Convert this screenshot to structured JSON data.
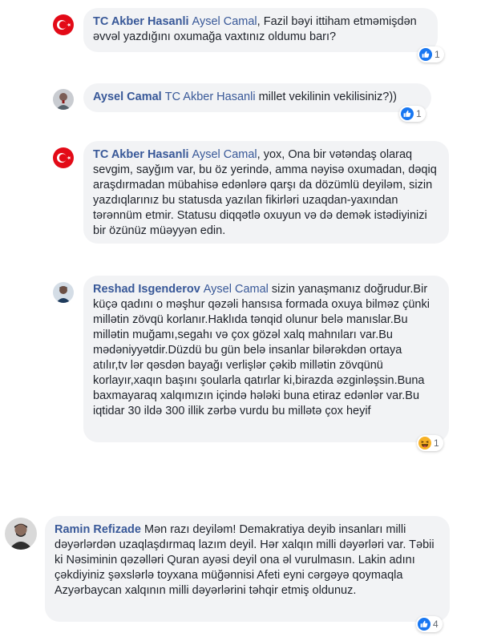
{
  "comments": [
    {
      "author": "TC Akber Hasanli",
      "mention": "Aysel Camal",
      "text": ", Fazil bəyi ittiham etməmişdən əvvəl yazdığını oxumağa vaxtınız oldumu barı?",
      "reaction": {
        "icon": "like-icon",
        "count": "1"
      },
      "avatar": "turkish-flag-avatar"
    },
    {
      "author": "Aysel Camal",
      "mention": "TC Akber Hasanli",
      "text": " millet vekilinin vekilisiniz?))",
      "reaction": {
        "icon": "like-icon",
        "count": "1"
      },
      "avatar": "user-photo-avatar"
    },
    {
      "author": "TC Akber Hasanli",
      "mention": "Aysel Camal",
      "text": ", yox, Ona bir vətəndaş olaraq sevgim, sayğım var, bu öz yerində, amma nəyisə oxumadan, dəqiq araşdırmadan mübahisə edənlərə qarşı da dözümlü deyiləm, sizin yazdıqlarınız bu statusda yazılan fikirləri uzaqdan-yaxından tərənnüm etmir. Statusu diqqətlə oxuyun və də demək istədiyinizi bir özünüz müəyyən edin.",
      "reaction": null,
      "avatar": "turkish-flag-avatar"
    },
    {
      "author": "Reshad Isgenderov",
      "mention": "Aysel Camal",
      "text": " sizin yanaşmanız doğrudur.Bir küçə qadını o məşhur qəzəli hansısa formada oxuya bilməz çünki millətin zövqü korlanır.Haklıda tənqid olunur belə manıslar.Bu millətin muğamı,segahı və çox gözəl xalq mahnıları var.Bu mədəniyyətdir.Düzdü bu gün belə insanlar bilərəkdən ortaya atılır,tv lər qəsdən bayağı verlişlər çəkib millətin zövqünü korlayır,xaqın başını şoularla qatırlar ki,birazda əzginləşsin.Buna baxmayaraq xalqımızın içində hələki buna etiraz edənlər var.Bu iqtidar 30 ildə 300 illik zərbə vurdu bu millətə çox heyif",
      "reaction": {
        "icon": "haha-icon",
        "count": "1"
      },
      "avatar": "user-photo-avatar"
    },
    {
      "author": "Ramin Refizade",
      "mention": "",
      "text": "Mən razı deyiləm! Demakratiya deyib insanları milli dəyərlərdən uzaqlaşdırmaq lazım deyil. Hər xalqın milli dəyərləri var. Təbii ki Nəsiminin qəzəlləri Quran ayəsi deyil ona əl vurulmasın. Lakin adını çəkdiyiniz şəxslərlə toyxana müğənnisi Afeti eyni cərgəyə qoymaqla Azyərbaycan xalqının milli dəyərlərini təhqir etmiş oldunuz.",
      "reaction": {
        "icon": "like-icon",
        "count": "4"
      },
      "avatar": "user-photo-avatar"
    }
  ],
  "colors": {
    "link": "#385898",
    "bubble": "#f2f3f5",
    "like": "#1877f2",
    "flag": "#e30a17"
  }
}
